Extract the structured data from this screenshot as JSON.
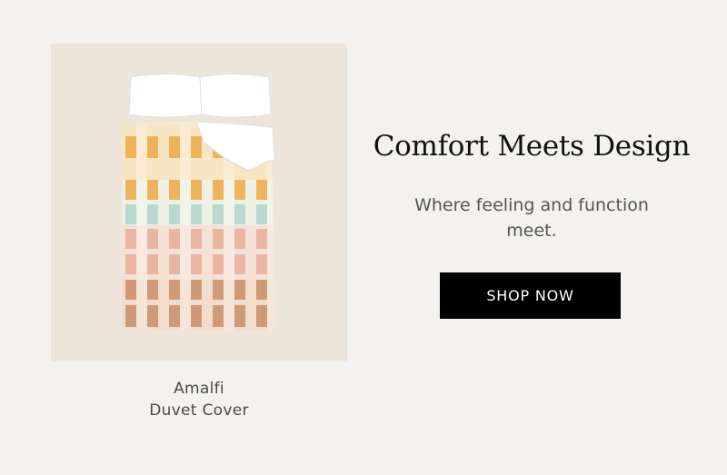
{
  "product": {
    "name_line1": "Amalfi",
    "name_line2": "Duvet Cover"
  },
  "promo": {
    "headline": "Comfort Meets Design",
    "subtext": "Where feeling and function meet.",
    "cta_label": "SHOP NOW"
  },
  "colors": {
    "background": "#f4f2ee",
    "card": "#ede4da",
    "button": "#000000",
    "button_text": "#ffffff"
  },
  "pattern_colors": [
    "#f0ad4e",
    "#b7d7cf",
    "#e9b39f",
    "#cc936e"
  ]
}
